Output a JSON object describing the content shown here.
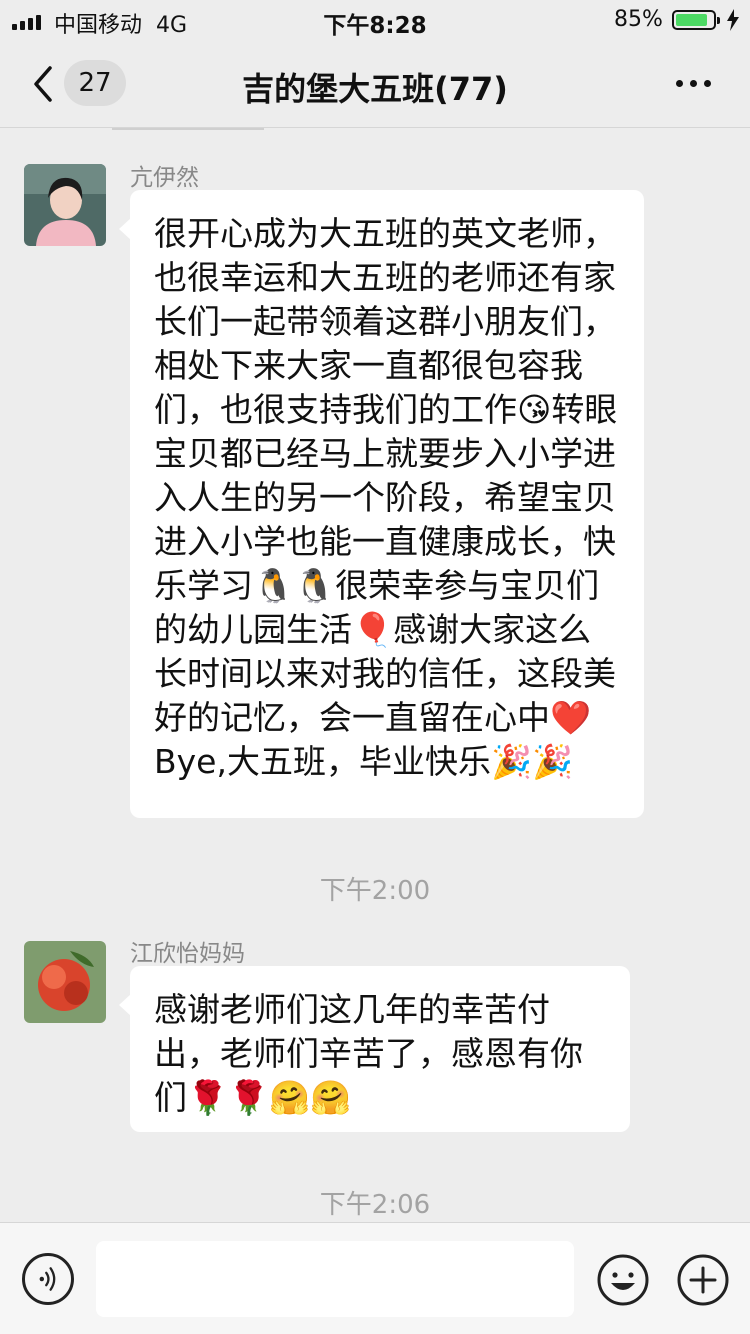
{
  "status_bar": {
    "carrier": "中国移动",
    "network": "4G",
    "time": "下午8:28",
    "battery_percent": "85%",
    "battery_level": 0.85
  },
  "nav": {
    "unread_count": "27",
    "title": "吉的堡大五班(77)"
  },
  "messages": [
    {
      "sender": "亢伊然",
      "text": "很开心成为大五班的英文老师，也很幸运和大五班的老师还有家长们一起带领着这群小朋友们，相处下来大家一直都很包容我们，也很支持我们的工作😘转眼宝贝都已经马上就要步入小学进入人生的另一个阶段，希望宝贝进入小学也能一直健康成长，快乐学习🐧🐧很荣幸参与宝贝们的幼儿园生活🎈感谢大家这么长时间以来对我的信任，这段美好的记忆，会一直留在心中❤️Bye,大五班，毕业快乐🎉🎉"
    },
    {
      "sender": "江欣怡妈妈",
      "text": "感谢老师们这几年的幸苦付出，老师们辛苦了，感恩有你们🌹🌹🤗🤗"
    }
  ],
  "timestamps": [
    "下午2:00",
    "下午2:06"
  ],
  "input": {
    "placeholder": ""
  },
  "colors": {
    "background": "#ededed",
    "bubble": "#ffffff",
    "timestamp": "#a3a3a3",
    "battery_fill": "#4cd964"
  }
}
